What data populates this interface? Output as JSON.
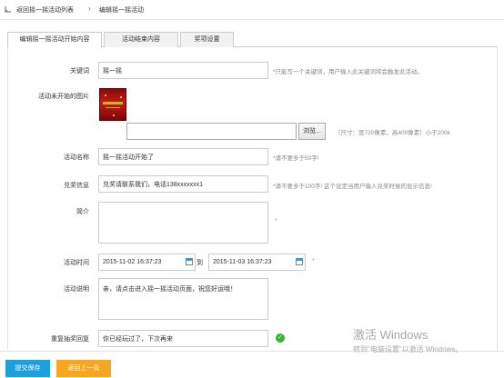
{
  "breadcrumb": {
    "back_label": "返回摇一摇活动列表",
    "separator": "›",
    "current": "编辑摇一摇活动"
  },
  "tabs": [
    {
      "label": "编辑摇一摇活动开始内容",
      "active": true
    },
    {
      "label": "活动结束内容",
      "active": false
    },
    {
      "label": "奖项设置",
      "active": false
    }
  ],
  "form": {
    "keyword": {
      "label": "关键词",
      "value": "摇一摇",
      "hint": "*只能写一个关键词，用户输入此关键词将会触发此活动。"
    },
    "image": {
      "label": "活动未开始的图片",
      "browse_label": "浏览...",
      "hint": "（尺寸：宽720像素，高400像素）小于200k"
    },
    "name": {
      "label": "活动名称",
      "value": "摇一摇活动开始了",
      "hint": "*请不要多于50字!"
    },
    "redeem": {
      "label": "兑奖信息",
      "value": "兑奖请联系我们，电话138xxxxxxx1",
      "hint": "*请不要多于100字! 这个设定当用户输入兑奖时候的显示信息!"
    },
    "intro": {
      "label": "简介",
      "value": "",
      "star": "*"
    },
    "time": {
      "label": "活动时间",
      "start": "2015-11-02 16:37:23",
      "to_label": "到",
      "end": "2015-11-03 16:37:23",
      "star": "*"
    },
    "desc": {
      "label": "活动说明",
      "value": "亲，请点击进入摇一摇活动页面，祝您好运哦！"
    },
    "repeat": {
      "label": "重复抽奖回复",
      "value": "你已经玩过了，下次再来"
    }
  },
  "buttons": {
    "submit": "提交保存",
    "back": "返回上一页"
  },
  "watermark": {
    "line1": "激活 Windows",
    "line2": "转到\"电脑设置\"以激活 Windows。"
  },
  "colors": {
    "primary": "#1e9fde",
    "warning": "#f5a623",
    "success": "#2eb82e"
  }
}
